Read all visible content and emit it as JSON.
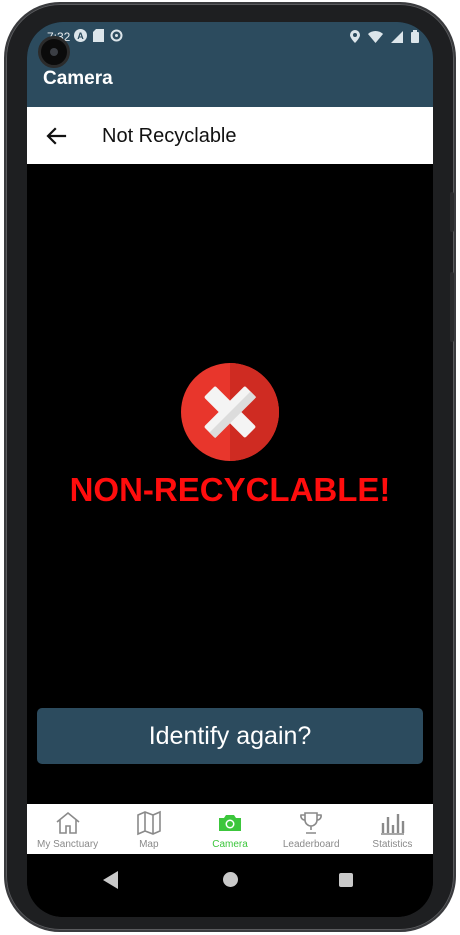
{
  "status_bar": {
    "time": "7:32",
    "left_icons": [
      "a-icon",
      "sd-card-icon",
      "data-saver-icon"
    ],
    "right_icons": [
      "location-icon",
      "wifi-icon",
      "signal-icon",
      "battery-icon"
    ]
  },
  "app_bar": {
    "title": "Camera"
  },
  "sub_header": {
    "title": "Not Recyclable",
    "back_icon": "arrow-left-icon"
  },
  "result": {
    "icon": "x-circle-icon",
    "text": "NON-RECYCLABLE!",
    "color": "#ff0d0d"
  },
  "actions": {
    "identify_again": "Identify again?"
  },
  "bottom_nav": {
    "active": "Camera",
    "items": [
      {
        "label": "My Sanctuary",
        "icon": "house-icon"
      },
      {
        "label": "Map",
        "icon": "map-icon"
      },
      {
        "label": "Camera",
        "icon": "camera-icon"
      },
      {
        "label": "Leaderboard",
        "icon": "trophy-icon"
      },
      {
        "label": "Statistics",
        "icon": "bar-chart-icon"
      }
    ]
  },
  "colors": {
    "primary": "#2c4b5e",
    "active_nav": "#3cc63c",
    "alert_red": "#ff0d0d"
  }
}
